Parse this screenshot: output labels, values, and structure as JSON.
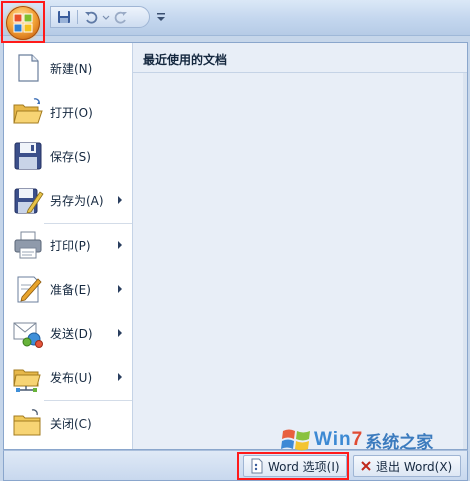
{
  "quick_access": {
    "icons": [
      "save-icon",
      "undo-icon",
      "redo-icon",
      "customize-dropdown-icon"
    ]
  },
  "menu": {
    "items": [
      {
        "label": "新建(N)",
        "icon": "new-document-icon",
        "has_submenu": false
      },
      {
        "label": "打开(O)",
        "icon": "open-folder-icon",
        "has_submenu": false
      },
      {
        "label": "保存(S)",
        "icon": "save-icon",
        "has_submenu": false
      },
      {
        "label": "另存为(A)",
        "icon": "save-as-icon",
        "has_submenu": true
      },
      {
        "label": "打印(P)",
        "icon": "printer-icon",
        "has_submenu": true
      },
      {
        "label": "准备(E)",
        "icon": "prepare-icon",
        "has_submenu": true
      },
      {
        "label": "发送(D)",
        "icon": "send-icon",
        "has_submenu": true
      },
      {
        "label": "发布(U)",
        "icon": "publish-icon",
        "has_submenu": true
      },
      {
        "label": "关闭(C)",
        "icon": "close-folder-icon",
        "has_submenu": false
      }
    ]
  },
  "recent": {
    "header": "最近使用的文档"
  },
  "bottom": {
    "word_options": "Word 选项(I)",
    "exit_word": "退出 Word(X)"
  },
  "watermark": {
    "latin_prefix": "Win",
    "latin_z": "7",
    "cn": "系统之家"
  },
  "colors": {
    "highlight": "#ff1a1a",
    "menu_bg": "#ffffff",
    "recent_bg": "#e8eef7",
    "office_orb": "#f4a53a"
  }
}
